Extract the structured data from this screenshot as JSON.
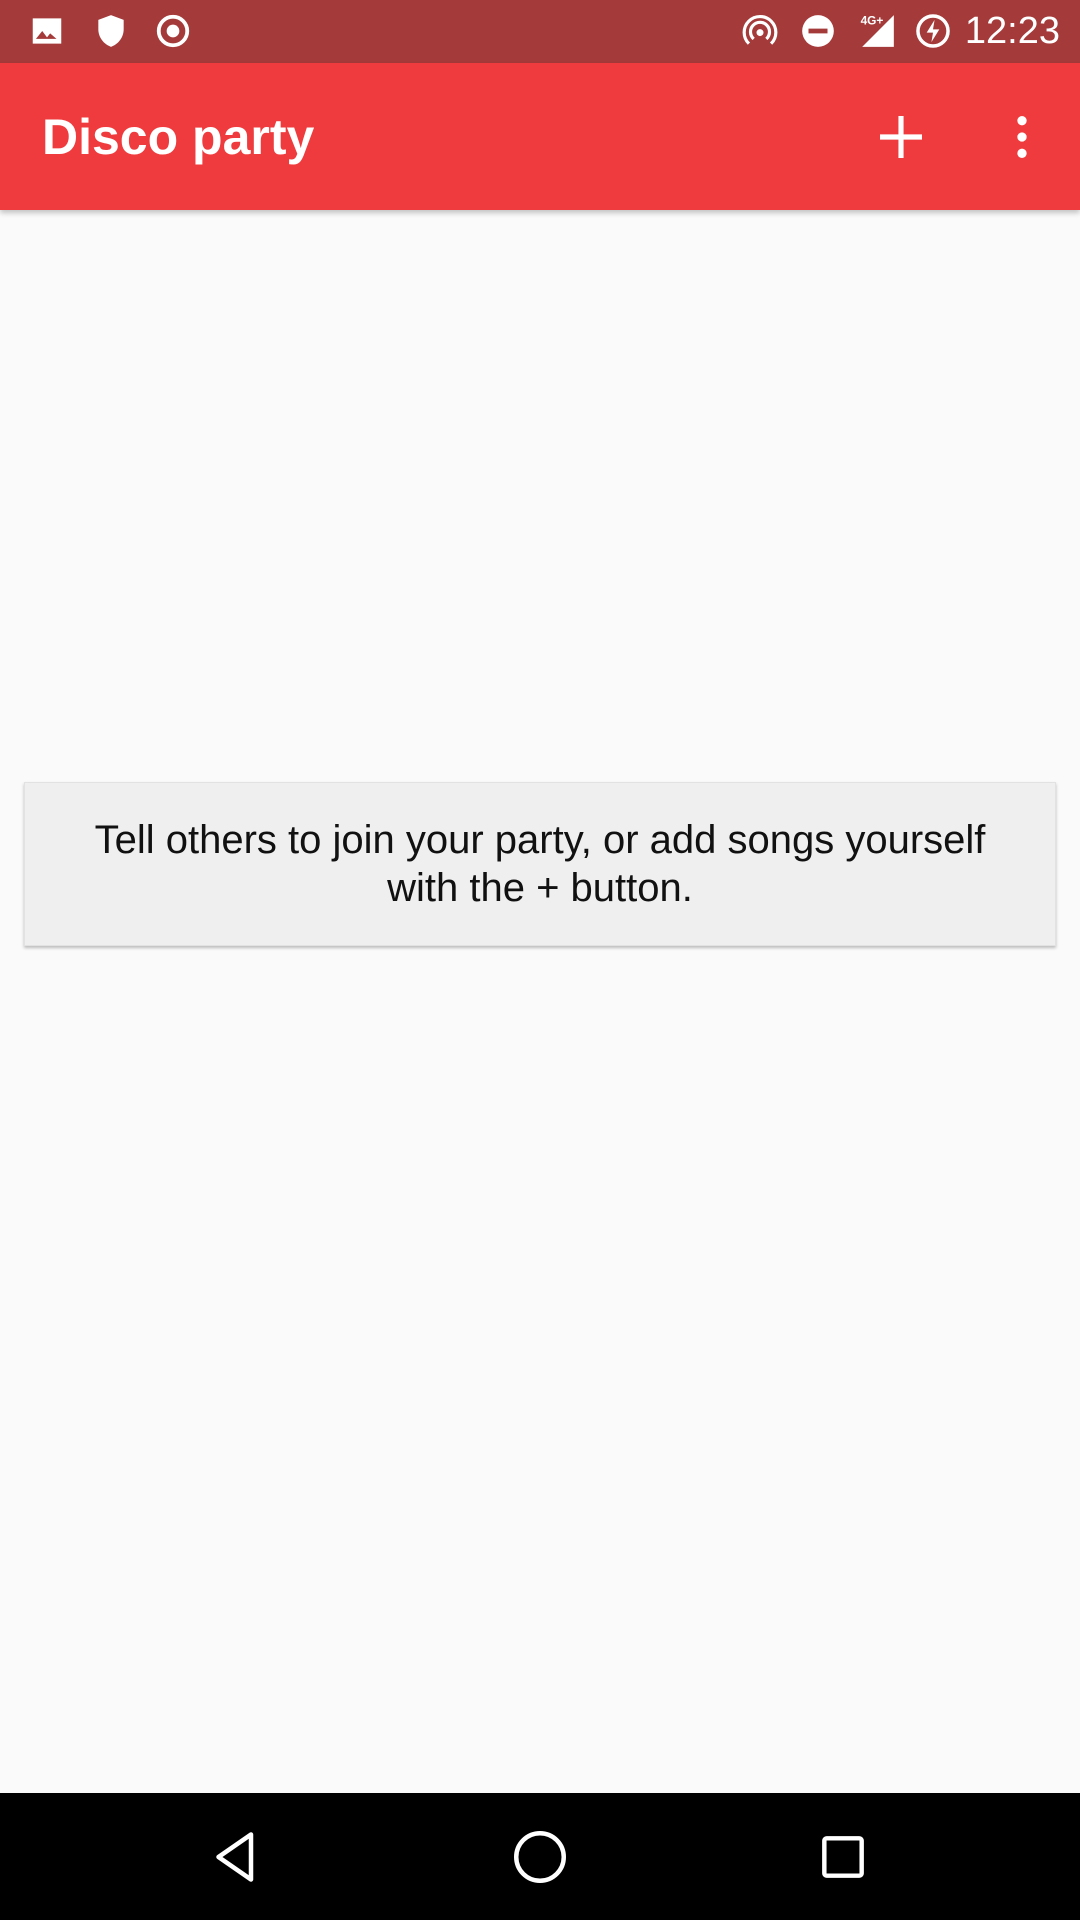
{
  "status_bar": {
    "time": "12:23",
    "network_label": "4G+",
    "left_icons": [
      "image-icon",
      "shield-icon",
      "record-icon"
    ],
    "right_icons": [
      "hotspot-icon",
      "do-not-disturb-icon",
      "signal-icon",
      "battery-charging-icon"
    ],
    "color": "#a53a3a"
  },
  "app_bar": {
    "title": "Disco party",
    "color": "#ef3b3d",
    "actions": [
      "add-icon",
      "more-vert-icon"
    ]
  },
  "main": {
    "empty_message": "Tell others to join your party, or add songs yourself with the + button."
  },
  "nav_bar": {
    "buttons": [
      "back-icon",
      "home-icon",
      "recents-icon"
    ]
  }
}
